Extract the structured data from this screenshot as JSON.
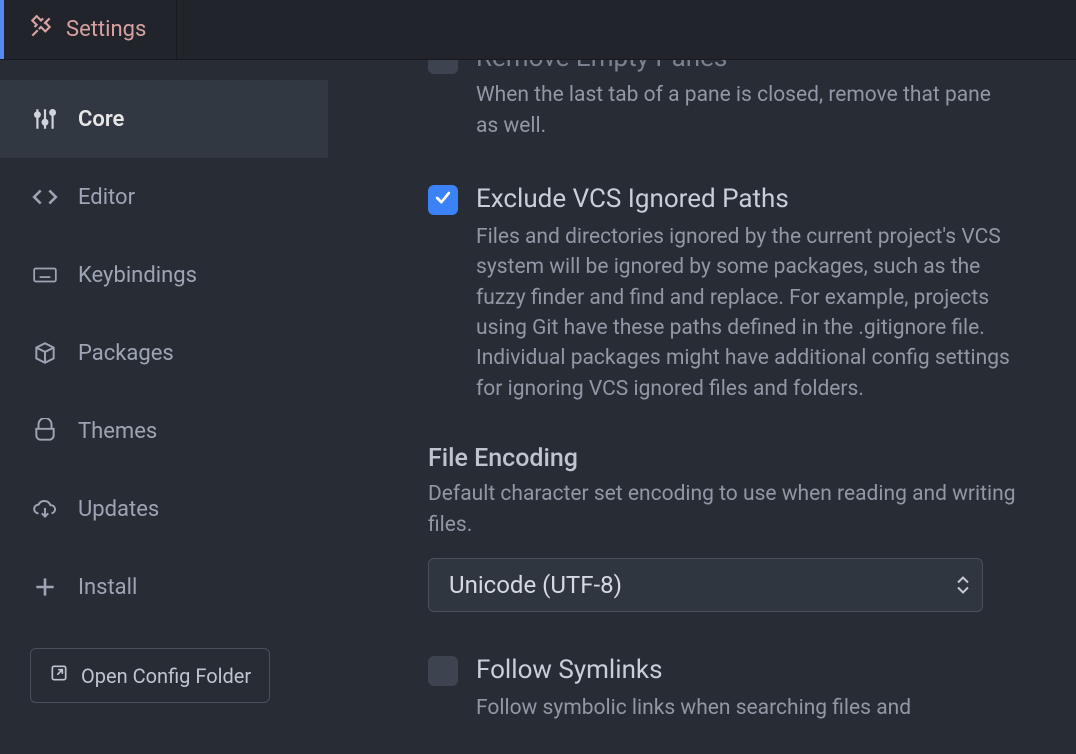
{
  "tab": {
    "label": "Settings"
  },
  "sidebar": {
    "items": [
      {
        "label": "Core"
      },
      {
        "label": "Editor"
      },
      {
        "label": "Keybindings"
      },
      {
        "label": "Packages"
      },
      {
        "label": "Themes"
      },
      {
        "label": "Updates"
      },
      {
        "label": "Install"
      }
    ],
    "openConfig": "Open Config Folder"
  },
  "settings": {
    "removePanes": {
      "title": "Remove Empty Panes",
      "desc": "When the last tab of a pane is closed, remove that pane as well."
    },
    "excludeVcs": {
      "title": "Exclude VCS Ignored Paths",
      "desc": "Files and directories ignored by the current project's VCS system will be ignored by some packages, such as the fuzzy finder and find and replace. For example, projects using Git have these paths defined in the .gitignore file. Individual packages might have additional config settings for ignoring VCS ignored files and folders."
    },
    "fileEncoding": {
      "heading": "File Encoding",
      "desc": "Default character set encoding to use when reading and writing files.",
      "value": "Unicode (UTF-8)"
    },
    "followSymlinks": {
      "title": "Follow Symlinks",
      "desc": "Follow symbolic links when searching files and"
    }
  }
}
